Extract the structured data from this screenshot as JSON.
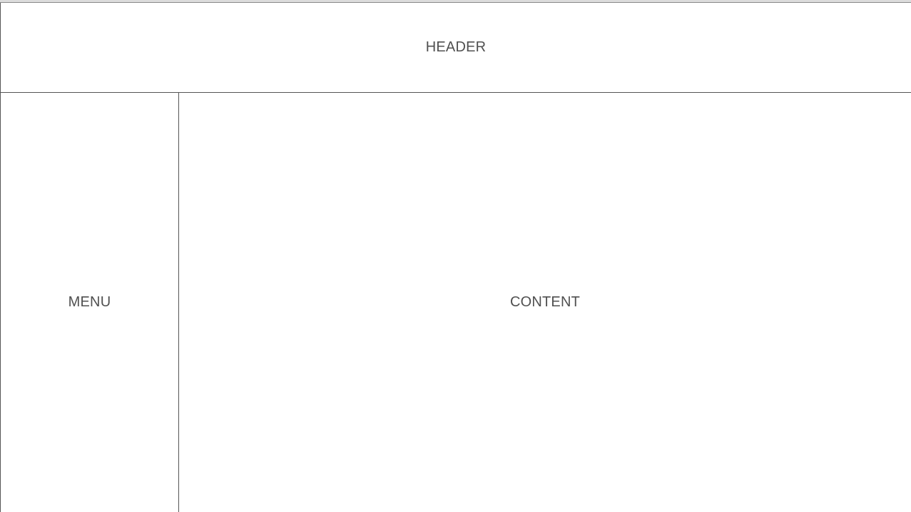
{
  "header": {
    "label": "HEADER"
  },
  "menu": {
    "label": "MENU"
  },
  "content": {
    "label": "CONTENT"
  }
}
